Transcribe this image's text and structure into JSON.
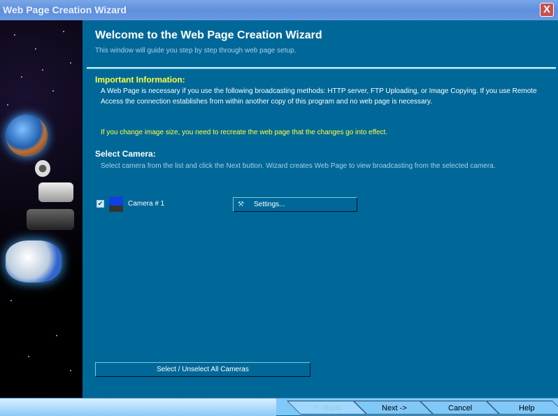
{
  "window": {
    "title": "Web Page Creation Wizard",
    "close_label": "X"
  },
  "header": {
    "title": "Welcome to the Web Page Creation Wizard",
    "subtitle": "This window will guide you step by step through web page setup."
  },
  "important": {
    "heading": "Important Information:",
    "text": "A Web Page is necessary if you use the following broadcasting methods: HTTP server, FTP Uploading, or Image Copying. If you use Remote Access the connection establishes from within another copy of this program and no web page is necessary.",
    "warning": "If you change image size, you need to recreate the web page that the changes go into effect."
  },
  "select_camera": {
    "heading": "Select Camera:",
    "instructions": "Select camera from the list and click the Next button. Wizard creates Web Page to view broadcasting from the selected camera.",
    "cameras": [
      {
        "label": "Camera # 1",
        "checked": true
      }
    ],
    "settings_label": "Settings...",
    "select_all_label": "Select / Unselect All Cameras"
  },
  "nav": {
    "back": "<- Back",
    "next": "Next ->",
    "cancel": "Cancel",
    "help": "Help"
  },
  "colors": {
    "background": "#006898",
    "highlight": "#ffff40",
    "titlebar": "#6a99e2"
  }
}
